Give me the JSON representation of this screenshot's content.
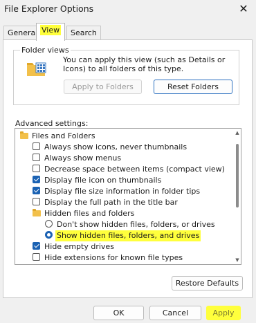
{
  "window": {
    "title": "File Explorer Options",
    "close_glyph": "✕"
  },
  "tabs": [
    {
      "label": "General"
    },
    {
      "label": "View"
    },
    {
      "label": "Search"
    }
  ],
  "folder_views": {
    "legend": "Folder views",
    "description": "You can apply this view (such as Details or Icons) to all folders of this type.",
    "apply_label": "Apply to Folders",
    "reset_label": "Reset Folders"
  },
  "advanced": {
    "label": "Advanced settings:",
    "items": [
      {
        "type": "folder",
        "label": "Files and Folders"
      },
      {
        "type": "checkbox",
        "checked": false,
        "label": "Always show icons, never thumbnails"
      },
      {
        "type": "checkbox",
        "checked": false,
        "label": "Always show menus"
      },
      {
        "type": "checkbox",
        "checked": false,
        "label": "Decrease space between items (compact view)"
      },
      {
        "type": "checkbox",
        "checked": true,
        "label": "Display file icon on thumbnails"
      },
      {
        "type": "checkbox",
        "checked": true,
        "label": "Display file size information in folder tips"
      },
      {
        "type": "checkbox",
        "checked": false,
        "label": "Display the full path in the title bar"
      },
      {
        "type": "folder",
        "label": "Hidden files and folders"
      },
      {
        "type": "radio",
        "checked": false,
        "label": "Don't show hidden files, folders, or drives"
      },
      {
        "type": "radio",
        "checked": true,
        "label": "Show hidden files, folders, and drives"
      },
      {
        "type": "checkbox",
        "checked": true,
        "label": "Hide empty drives"
      },
      {
        "type": "checkbox",
        "checked": false,
        "label": "Hide extensions for known file types"
      }
    ]
  },
  "restore_label": "Restore Defaults",
  "footer": {
    "ok": "OK",
    "cancel": "Cancel",
    "apply": "Apply"
  },
  "colors": {
    "highlight": "#ffff3c",
    "accent": "#1b62b3"
  }
}
